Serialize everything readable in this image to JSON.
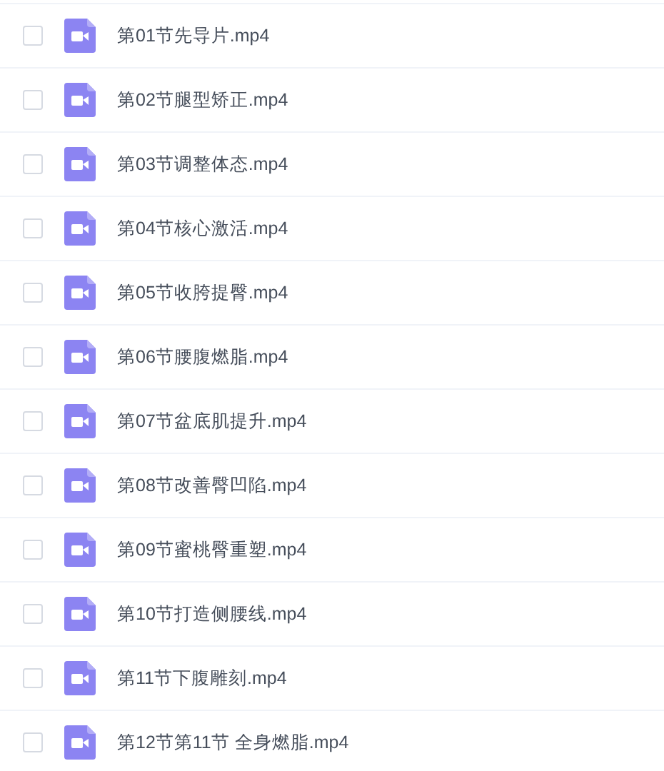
{
  "files": [
    {
      "name": "第01节先导片.mp4",
      "checked": false
    },
    {
      "name": "第02节腿型矫正.mp4",
      "checked": false
    },
    {
      "name": "第03节调整体态.mp4",
      "checked": false
    },
    {
      "name": "第04节核心激活.mp4",
      "checked": false
    },
    {
      "name": "第05节收胯提臀.mp4",
      "checked": false
    },
    {
      "name": "第06节腰腹燃脂.mp4",
      "checked": false
    },
    {
      "name": "第07节盆底肌提升.mp4",
      "checked": false
    },
    {
      "name": "第08节改善臀凹陷.mp4",
      "checked": false
    },
    {
      "name": "第09节蜜桃臀重塑.mp4",
      "checked": false
    },
    {
      "name": "第10节打造侧腰线.mp4",
      "checked": false
    },
    {
      "name": "第11节下腹雕刻.mp4",
      "checked": false
    },
    {
      "name": "第12节第11节 全身燃脂.mp4",
      "checked": false
    }
  ]
}
